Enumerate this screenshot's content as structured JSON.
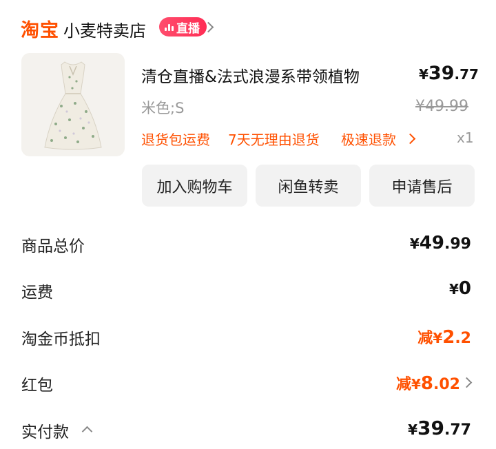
{
  "header": {
    "brand": "淘宝",
    "store_name": "小麦特卖店",
    "live_badge": "直播"
  },
  "product": {
    "title": "清仓直播&法式浪漫系带领植物",
    "price_symbol": "¥",
    "price_int": "39",
    "price_dec": ".77",
    "sku": "米色;S",
    "original_price": "¥49.99",
    "services": [
      "退货包运费",
      "7天无理由退货",
      "极速退款"
    ],
    "quantity": "x1"
  },
  "actions": {
    "add_to_cart": "加入购物车",
    "resell": "闲鱼转卖",
    "after_sale": "申请售后"
  },
  "summary": {
    "total_label": "商品总价",
    "total_symbol": "¥",
    "total_int": "49",
    "total_dec": ".99",
    "shipping_label": "运费",
    "shipping_symbol": "¥",
    "shipping_value": "0",
    "coin_label": "淘金币抵扣",
    "coin_prefix": "减",
    "coin_symbol": "¥",
    "coin_int": "2",
    "coin_dec": ".2",
    "redpacket_label": "红包",
    "redpacket_prefix": "减",
    "redpacket_symbol": "¥",
    "redpacket_int": "8",
    "redpacket_dec": ".02",
    "paid_label": "实付款",
    "paid_symbol": "¥",
    "paid_int": "39",
    "paid_dec": ".77"
  },
  "colors": {
    "accent": "#ff5000",
    "live_badge": "#ff2d55",
    "muted": "#999999",
    "button_bg": "#f2f2f2"
  }
}
